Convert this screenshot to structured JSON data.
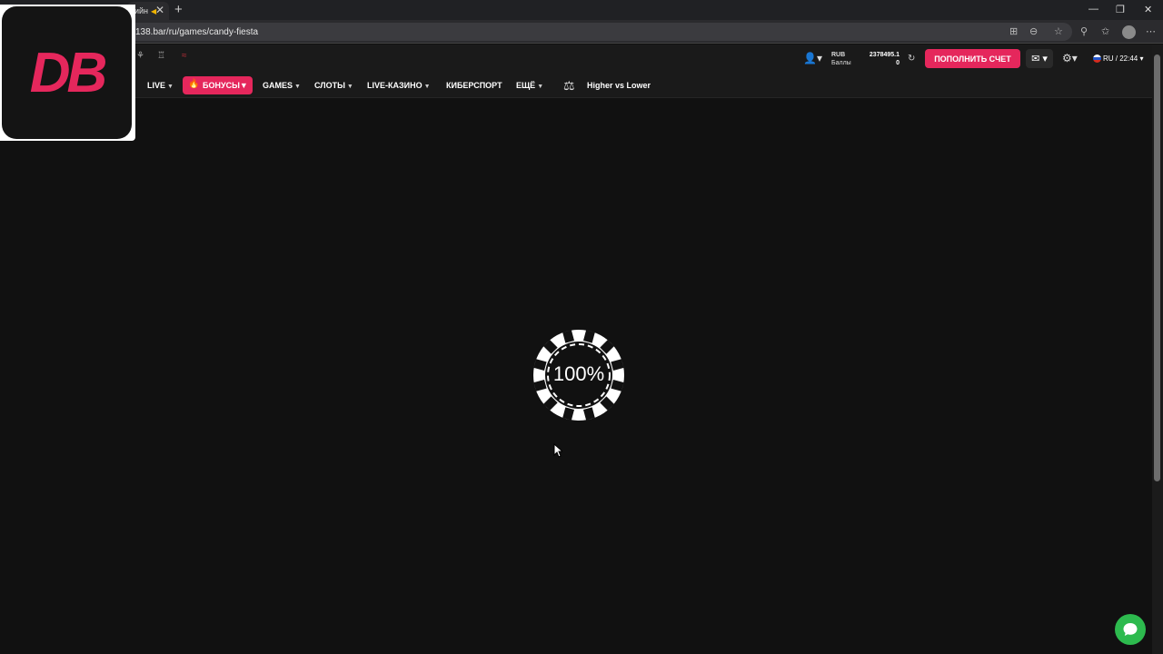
{
  "browser": {
    "tab_title": "ийн",
    "tab_close": "✕",
    "new_tab": "+",
    "url": "138.bar/ru/games/candy-fiesta",
    "minimize": "—",
    "restore": "❐",
    "close": "✕"
  },
  "logo": {
    "text": "DB",
    "accent": "#e5275c"
  },
  "nav": {
    "items": [
      {
        "label": "LIVE"
      },
      {
        "label": "БОНУСЫ"
      },
      {
        "label": "GAMES"
      },
      {
        "label": "СЛОТЫ"
      },
      {
        "label": "LIVE-КАЗИНО"
      },
      {
        "label": "КИБЕРСПОРТ"
      },
      {
        "label": "ЕЩЁ"
      },
      {
        "label": "Higher vs Lower"
      }
    ]
  },
  "account": {
    "currency": "RUB",
    "points_label": "Баллы",
    "balance": "2378495.1",
    "points": "0",
    "deposit_label": "ПОПОЛНИТЬ СЧЕТ",
    "lang_time": "RU / 22:44"
  },
  "loader": {
    "percent": "100%"
  },
  "colors": {
    "background": "#111111",
    "accent": "#e5275c",
    "chat": "#2dba4e"
  }
}
